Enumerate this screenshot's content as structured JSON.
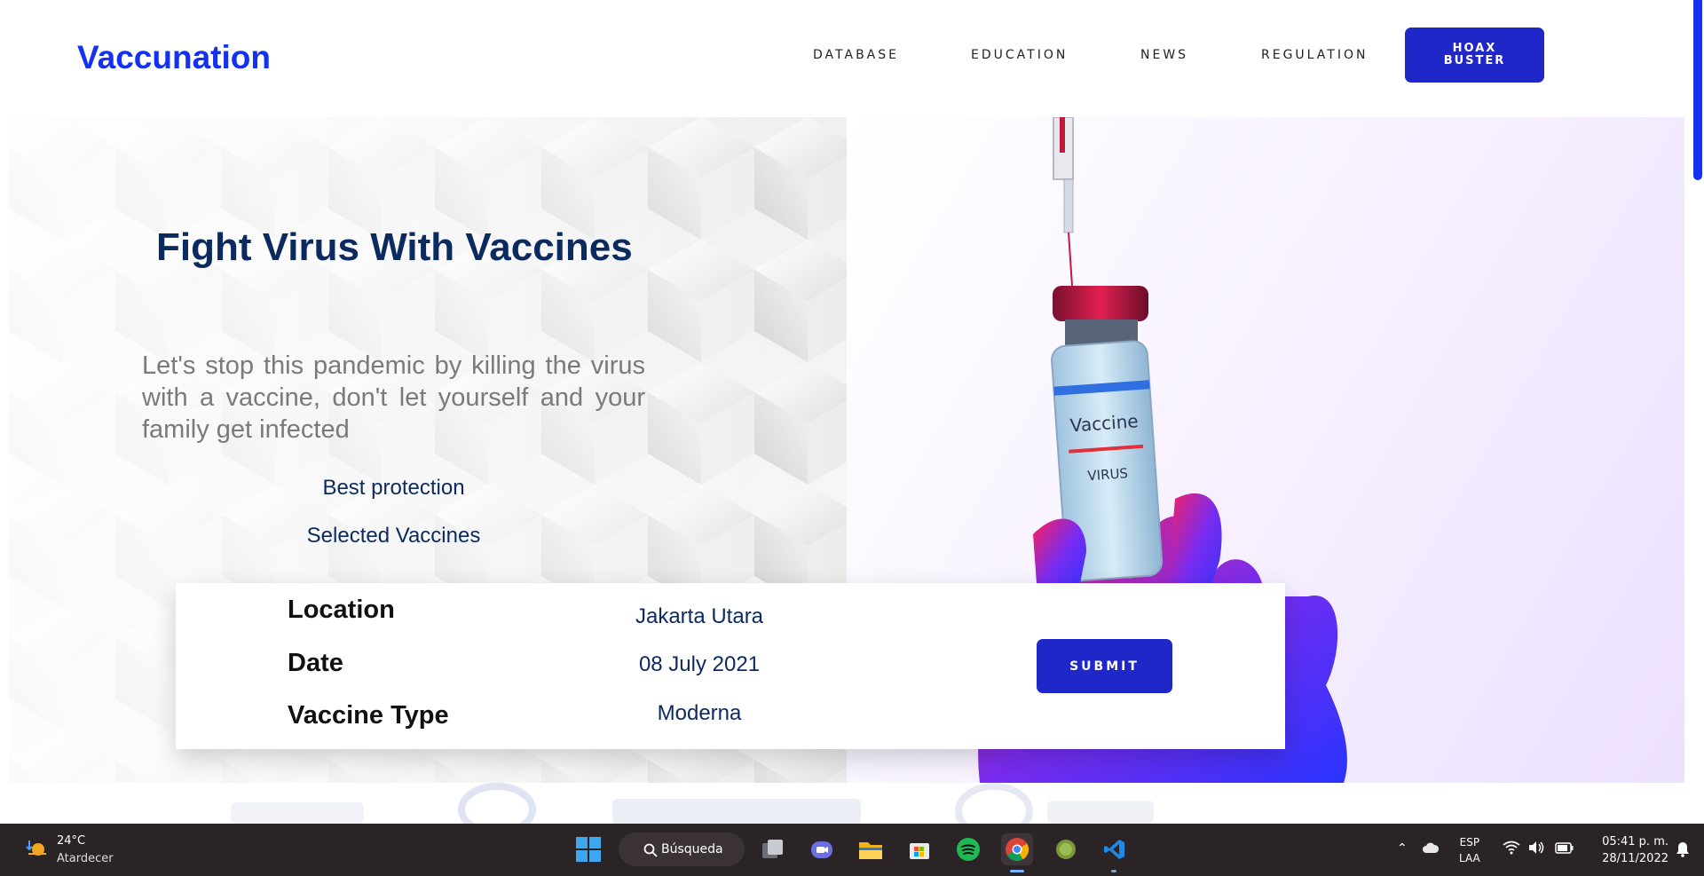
{
  "brand": {
    "logo": "Vaccunation"
  },
  "nav": {
    "items": [
      {
        "label": "DATABASE"
      },
      {
        "label": "EDUCATION"
      },
      {
        "label": "NEWS"
      },
      {
        "label": "REGULATION"
      }
    ],
    "cta_label": "HOAX\nBUSTER"
  },
  "hero": {
    "title": "Fight Virus With Vaccines",
    "text": "Let's stop this pandemic by killing the virus with a vaccine, don't let yourself and your family get infected",
    "taglines": [
      "Best protection",
      "Selected Vaccines"
    ],
    "image": {
      "vial_label": "Vaccine",
      "vial_sublabel": "VIRUS"
    }
  },
  "booking": {
    "fields": [
      {
        "label": "Location",
        "value": "Jakarta Utara"
      },
      {
        "label": "Date",
        "value": "08 July 2021"
      },
      {
        "label": "Vaccine Type",
        "value": "Moderna"
      }
    ],
    "submit_label": "SUBMIT"
  },
  "taskbar": {
    "weather": {
      "temp": "24°C",
      "condition": "Atardecer"
    },
    "search_label": "Búsqueda",
    "apps": [
      "task-view",
      "teams-chat",
      "file-explorer",
      "microsoft-store",
      "spotify",
      "chrome",
      "minecraft",
      "vscode"
    ],
    "lang": {
      "line1": "ESP",
      "line2": "LAA"
    },
    "time": "05:41 p. m.",
    "date": "28/11/2022"
  },
  "colors": {
    "brand": "#1431f0",
    "button": "#2027c9",
    "title": "#0b2a5f",
    "taskbar": "#2b2426"
  }
}
